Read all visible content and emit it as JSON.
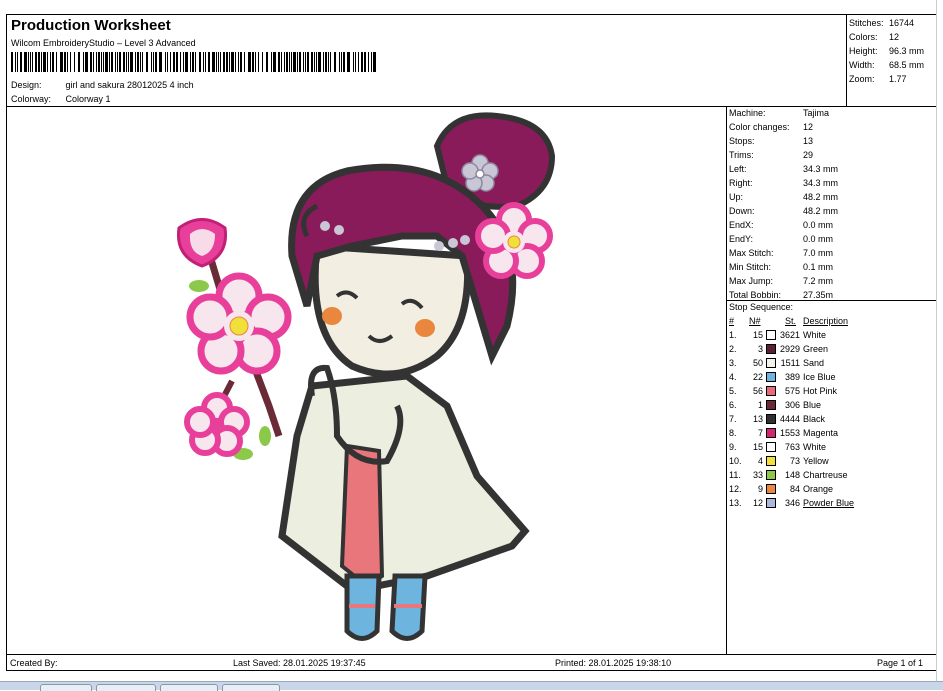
{
  "header": {
    "title": "Production Worksheet",
    "subtitle": "Wilcom EmbroideryStudio – Level 3 Advanced",
    "design_label": "Design:",
    "design_value": "girl and sakura 28012025 4 inch",
    "colorway_label": "Colorway:",
    "colorway_value": "Colorway 1"
  },
  "top_stats": [
    {
      "label": "Stitches:",
      "value": "16744"
    },
    {
      "label": "Colors:",
      "value": "12"
    },
    {
      "label": "Height:",
      "value": "96.3 mm"
    },
    {
      "label": "Width:",
      "value": "68.5 mm"
    },
    {
      "label": "Zoom:",
      "value": "1.77"
    }
  ],
  "machine": [
    {
      "label": "Machine:",
      "value": "Tajima"
    },
    {
      "label": "Color changes:",
      "value": "12"
    },
    {
      "label": "Stops:",
      "value": "13"
    },
    {
      "label": "Trims:",
      "value": "29"
    },
    {
      "label": "Left:",
      "value": "34.3 mm"
    },
    {
      "label": "Right:",
      "value": "34.3 mm"
    },
    {
      "label": "Up:",
      "value": "48.2 mm"
    },
    {
      "label": "Down:",
      "value": "48.2 mm"
    },
    {
      "label": "EndX:",
      "value": "0.0 mm"
    },
    {
      "label": "EndY:",
      "value": "0.0 mm"
    },
    {
      "label": "Max Stitch:",
      "value": "7.0 mm"
    },
    {
      "label": "Min Stitch:",
      "value": "0.1 mm"
    },
    {
      "label": "Max Jump:",
      "value": "7.2 mm"
    },
    {
      "label": "Total Bobbin:",
      "value": "27.35m"
    }
  ],
  "stop_sequence": {
    "label": "Stop Sequence:",
    "headers": {
      "num": "#",
      "n": "N#",
      "st": "St.",
      "desc": "Description"
    },
    "rows": [
      {
        "num": "1.",
        "n": "15",
        "st": "3621",
        "desc": "White",
        "color": "#ffffff"
      },
      {
        "num": "2.",
        "n": "3",
        "st": "2929",
        "desc": "Green",
        "color": "#5a1f33"
      },
      {
        "num": "3.",
        "n": "50",
        "st": "1511",
        "desc": "Sand",
        "color": "#f4f1ea"
      },
      {
        "num": "4.",
        "n": "22",
        "st": "389",
        "desc": "Ice Blue",
        "color": "#6db4df"
      },
      {
        "num": "5.",
        "n": "56",
        "st": "575",
        "desc": "Hot Pink",
        "color": "#e86a78"
      },
      {
        "num": "6.",
        "n": "1",
        "st": "306",
        "desc": "Blue",
        "color": "#6a2a36"
      },
      {
        "num": "7.",
        "n": "13",
        "st": "4444",
        "desc": "Black",
        "color": "#2f2f2f"
      },
      {
        "num": "8.",
        "n": "7",
        "st": "1553",
        "desc": "Magenta",
        "color": "#d4246f"
      },
      {
        "num": "9.",
        "n": "15",
        "st": "763",
        "desc": "White",
        "color": "#ffffff"
      },
      {
        "num": "10.",
        "n": "4",
        "st": "73",
        "desc": "Yellow",
        "color": "#f0e03a"
      },
      {
        "num": "11.",
        "n": "33",
        "st": "148",
        "desc": "Chartreuse",
        "color": "#8cc84a"
      },
      {
        "num": "12.",
        "n": "9",
        "st": "84",
        "desc": "Orange",
        "color": "#e9873e"
      },
      {
        "num": "13.",
        "n": "12",
        "st": "346",
        "desc": "Powder Blue",
        "color": "#a9b8dc"
      }
    ]
  },
  "footer": {
    "created_by": "Created By:",
    "last_saved": "Last Saved: 28.01.2025 19:37:45",
    "printed": "Printed: 28.01.2025 19:38:10",
    "page": "Page 1 of 1"
  }
}
